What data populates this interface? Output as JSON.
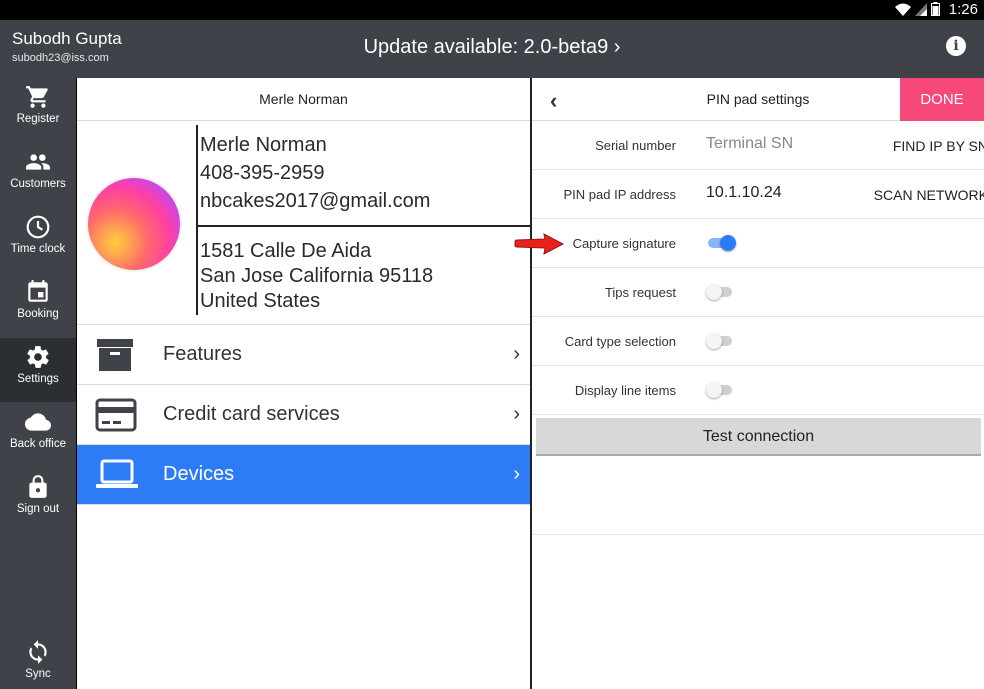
{
  "status_bar": {
    "time": "1:26"
  },
  "header": {
    "user_name": "Subodh Gupta",
    "user_email": "subodh23@iss.com",
    "update_text": "Update available: 2.0-beta9 ›",
    "info_icon": "info-icon"
  },
  "sidebar": {
    "items": [
      {
        "label": "Register",
        "icon": "cart-icon"
      },
      {
        "label": "Customers",
        "icon": "people-icon"
      },
      {
        "label": "Time clock",
        "icon": "clock-icon"
      },
      {
        "label": "Booking",
        "icon": "calendar-icon"
      },
      {
        "label": "Settings",
        "icon": "gear-icon",
        "active": true
      },
      {
        "label": "Back office",
        "icon": "cloud-icon"
      },
      {
        "label": "Sign out",
        "icon": "lock-icon"
      },
      {
        "label": "Sync",
        "icon": "sync-icon"
      }
    ]
  },
  "customer_panel": {
    "title": "Merle Norman",
    "name": "Merle Norman",
    "phone": "408-395-2959",
    "email": "nbcakes2017@gmail.com",
    "address_line1": "1581 Calle De Aida",
    "address_line2": "San Jose California 95118",
    "address_line3": "United States"
  },
  "menu": {
    "items": [
      {
        "label": "Features",
        "icon": "archive-icon",
        "chevron": "›"
      },
      {
        "label": "Credit card services",
        "icon": "credit-card-icon",
        "chevron": "›"
      },
      {
        "label": "Devices",
        "icon": "laptop-icon",
        "chevron": "›",
        "selected": true
      }
    ]
  },
  "pin_pad": {
    "back": "‹",
    "title": "PIN pad settings",
    "done_label": "DONE",
    "serial_label": "Serial number",
    "serial_placeholder": "Terminal SN",
    "find_ip_label": "FIND IP BY SN",
    "ip_label": "PIN pad IP address",
    "ip_value": "10.1.10.24",
    "scan_label": "SCAN NETWORK",
    "capture_signature_label": "Capture signature",
    "capture_signature_on": true,
    "tips_label": "Tips request",
    "tips_on": false,
    "card_type_label": "Card type selection",
    "card_type_on": false,
    "line_items_label": "Display line items",
    "line_items_on": false,
    "test_connection_label": "Test connection"
  },
  "colors": {
    "sidebar_bg": "#3f4349",
    "selected_row": "#2e7bf6",
    "done_button": "#f7487a",
    "annotation_arrow": "#e8211c"
  }
}
